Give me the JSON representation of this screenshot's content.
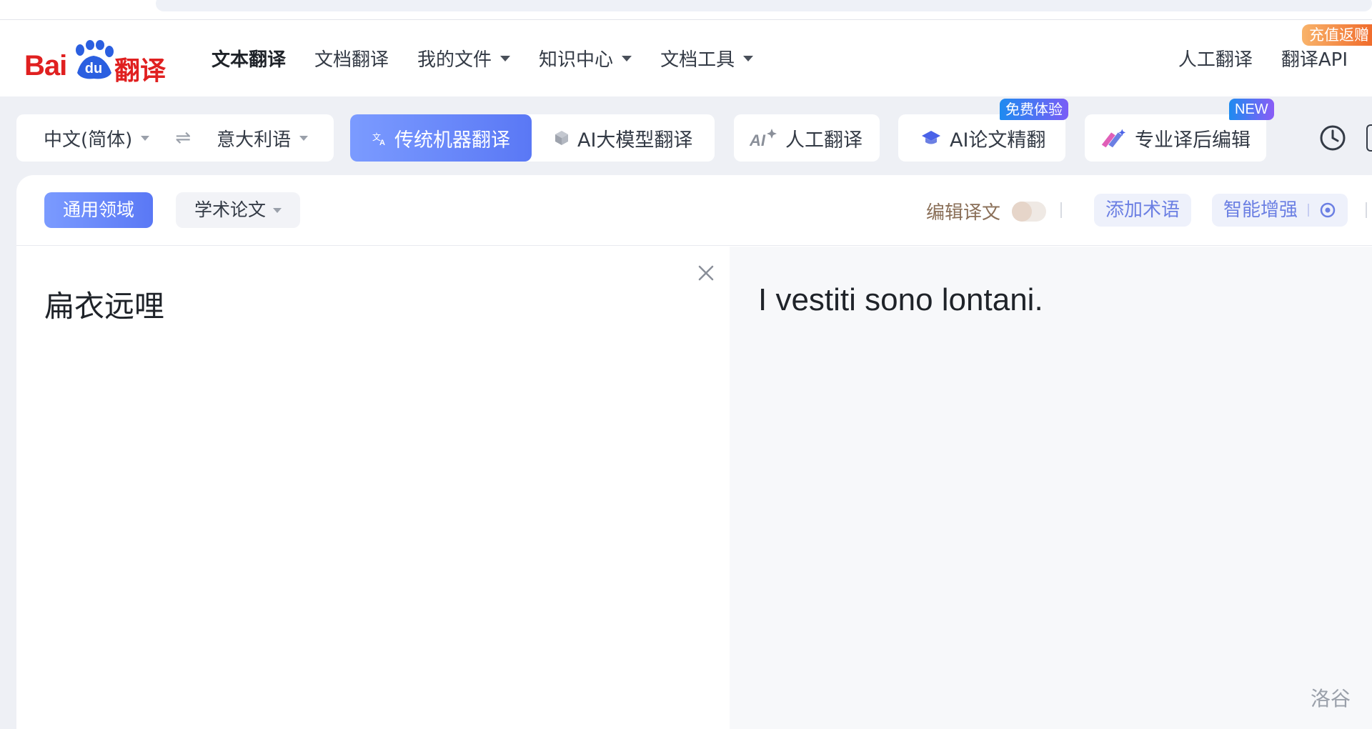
{
  "logo": {
    "bai": "Bai",
    "du": "du",
    "fanyi": "翻译"
  },
  "nav": {
    "items": [
      {
        "label": "文本翻译",
        "active": true,
        "dropdown": false
      },
      {
        "label": "文档翻译",
        "active": false,
        "dropdown": false
      },
      {
        "label": "我的文件",
        "active": false,
        "dropdown": true
      },
      {
        "label": "知识中心",
        "active": false,
        "dropdown": true
      },
      {
        "label": "文档工具",
        "active": false,
        "dropdown": true
      }
    ],
    "right": [
      {
        "label": "人工翻译"
      },
      {
        "label": "翻译API"
      }
    ],
    "topup_badge": "充值返赠"
  },
  "languages": {
    "source": "中文(简体)",
    "target": "意大利语",
    "swap_icon": "swap-icon"
  },
  "modes": [
    {
      "label": "传统机器翻译",
      "active": true,
      "icon": "translate-icon"
    },
    {
      "label": "AI大模型翻译",
      "active": false,
      "icon": "cube-icon"
    }
  ],
  "tools": [
    {
      "label": "人工翻译",
      "icon": "ai-sparkle-icon"
    },
    {
      "label": "AI论文精翻",
      "icon": "graduation-cap-icon",
      "badge": "免费体验"
    },
    {
      "label": "专业译后编辑",
      "icon": "pen-edit-icon",
      "badge": "NEW"
    }
  ],
  "domains": {
    "general": "通用领域",
    "academic": "学术论文"
  },
  "edit_translation": {
    "label": "编辑译文",
    "enabled": false
  },
  "actions": {
    "add_terms": "添加术语",
    "smart_enhance": "智能增强"
  },
  "source_text": "扁衣远哩",
  "target_text": "I vestiti sono lontani.",
  "watermark": "洛谷",
  "colors": {
    "accent": "#5a78f5",
    "brand_red": "#e02020",
    "badge_blue": "#1e8bf0",
    "badge_purple": "#8a5cf6"
  }
}
